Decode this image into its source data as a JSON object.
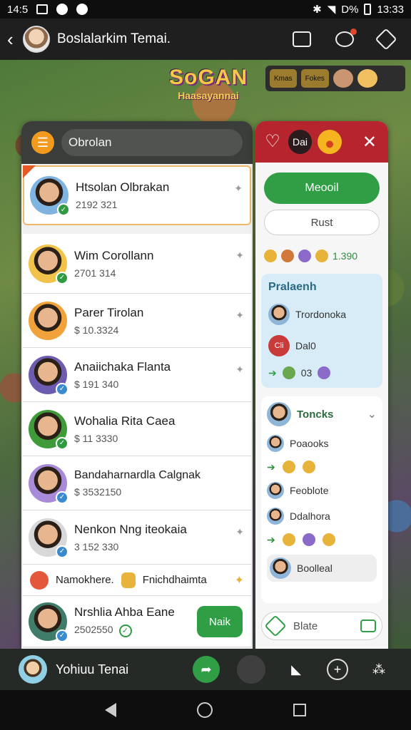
{
  "status": {
    "time": "14:5",
    "clock": "13:33",
    "battery": "D%"
  },
  "appbar": {
    "title": "Boslalarkim Temai."
  },
  "game": {
    "logo_line1": "SoGAN",
    "logo_line2": "Haasayannai",
    "mini_cards": [
      "Kmas",
      "Fokes"
    ]
  },
  "chat": {
    "search_placeholder": "Obrolan",
    "rows": [
      {
        "name": "Htsolan Olbrakan",
        "sub": "2192 321",
        "color": "#7fb3e0"
      },
      {
        "name": "Wim Corollann",
        "sub": "2701 314",
        "color": "#f1c34a"
      },
      {
        "name": "Parer Tirolan",
        "sub": "$ 10.3324",
        "color": "#f2a23a"
      },
      {
        "name": "Anaiichaka Flanta",
        "sub": "$ 191 340",
        "color": "#6d5bb0"
      },
      {
        "name": "Wohalia Rita Caea",
        "sub": "$ 11 3330",
        "color": "#3f9a3a"
      },
      {
        "name": "Bandaharnardla Calgnak",
        "sub": "$ 3532150",
        "color": "#a78ad8"
      },
      {
        "name": "Nenkon Nng iteokaia",
        "sub": "3 152 330",
        "color": "#d8d8d8"
      }
    ],
    "emoji_row": {
      "left": "Namokhere.",
      "right": "Fnichdhaimta"
    },
    "last_row": {
      "name": "Nrshlia Ahba Eane",
      "sub": "2502550",
      "button": "Naik"
    }
  },
  "side": {
    "pill": "Dai",
    "primary_button": "Meooil",
    "secondary_button": "Rust",
    "reward_value": "1.390",
    "info": {
      "title": "Pralaenh",
      "line1": "Trordonoka",
      "line2_badge": "Cli",
      "line2_text": "Dal0",
      "line3_text": "03"
    },
    "friends": {
      "title": "Toncks",
      "items": [
        "Poaooks",
        "Feoblote",
        "Ddalhora",
        "Boolleal"
      ]
    },
    "footer": "Blate"
  },
  "gamebar": {
    "name": "Yohiuu Tenai"
  },
  "colors": {
    "green": "#2f9e45",
    "red_header": "#b6252d",
    "orange": "#f29a1e"
  }
}
